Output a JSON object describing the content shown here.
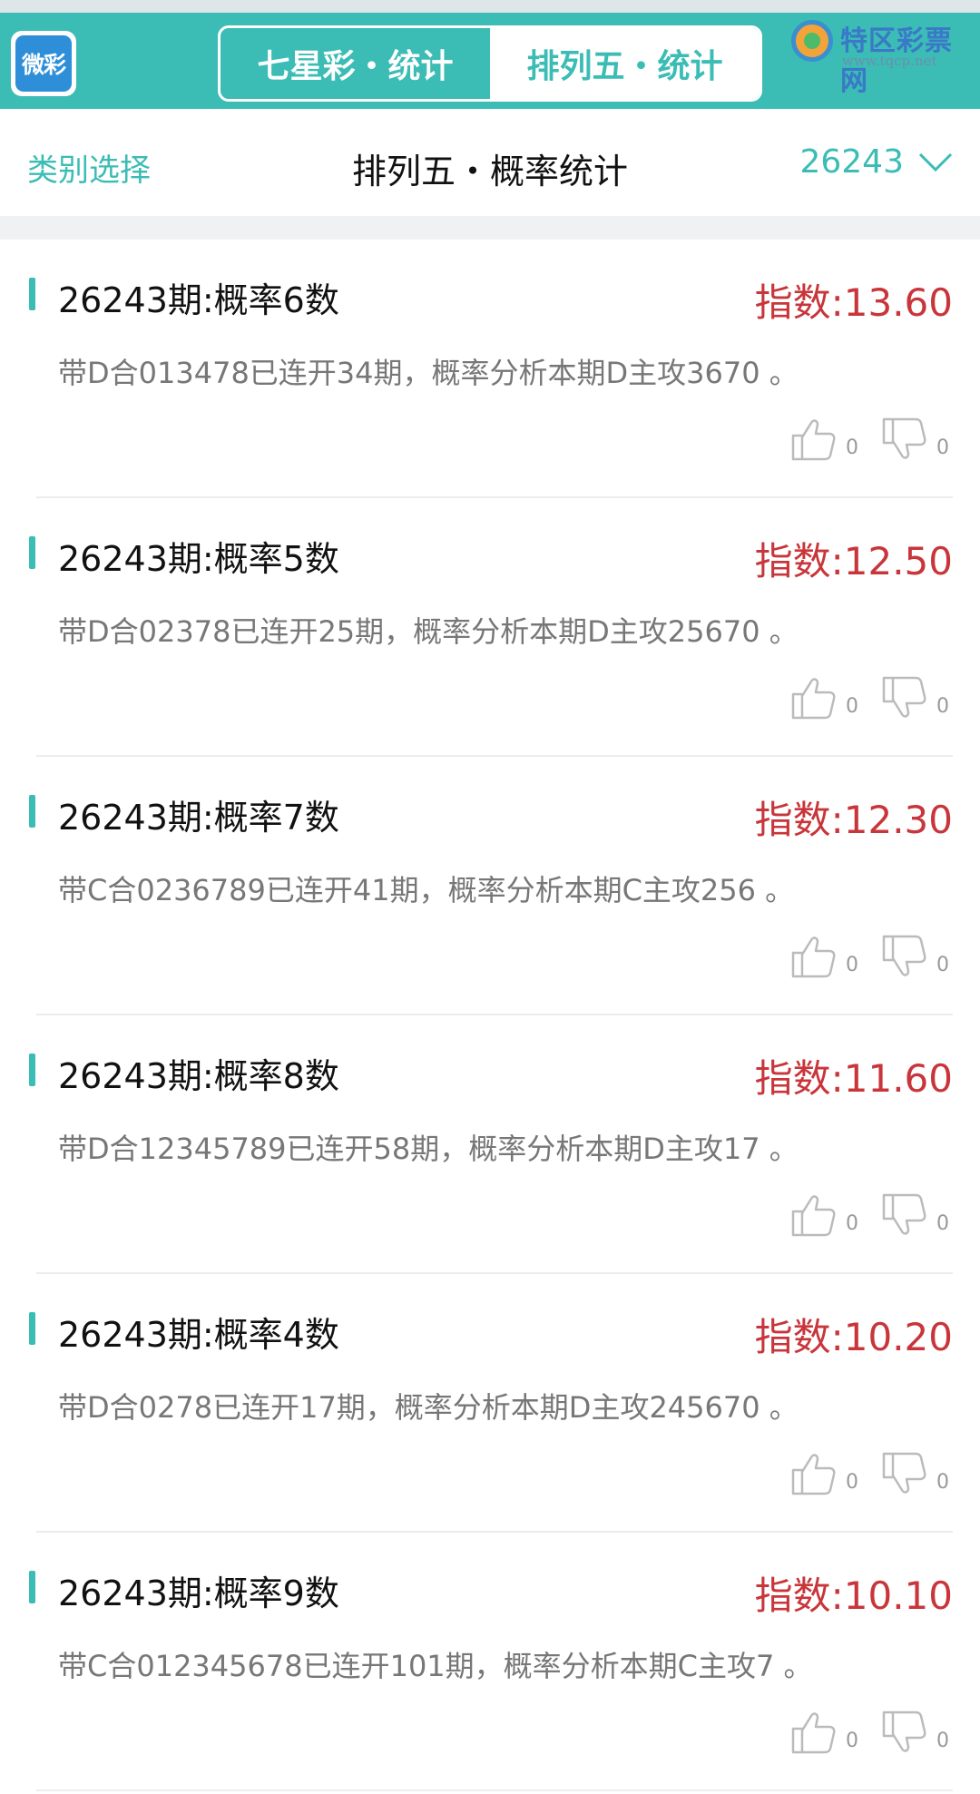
{
  "header": {
    "logo_text": "微彩",
    "tabs": [
      {
        "label": "七星彩・统计",
        "active": false
      },
      {
        "label": "排列五・统计",
        "active": true
      }
    ],
    "watermark": {
      "title": "特区彩票网",
      "url": "www.tqcp.net"
    }
  },
  "subheader": {
    "category_select": "类别选择",
    "title": "排列五・概率统计",
    "issue": "26243"
  },
  "colors": {
    "accent": "#3bbcb4",
    "index_red": "#c8353a"
  },
  "items": [
    {
      "title": "26243期:概率6数",
      "index": "指数:13.60",
      "desc": "带D合013478已连开34期，概率分析本期D主攻3670 。",
      "likes": "0",
      "dislikes": "0"
    },
    {
      "title": "26243期:概率5数",
      "index": "指数:12.50",
      "desc": "带D合02378已连开25期，概率分析本期D主攻25670 。",
      "likes": "0",
      "dislikes": "0"
    },
    {
      "title": "26243期:概率7数",
      "index": "指数:12.30",
      "desc": "带C合0236789已连开41期，概率分析本期C主攻256 。",
      "likes": "0",
      "dislikes": "0"
    },
    {
      "title": "26243期:概率8数",
      "index": "指数:11.60",
      "desc": "带D合12345789已连开58期，概率分析本期D主攻17 。",
      "likes": "0",
      "dislikes": "0"
    },
    {
      "title": "26243期:概率4数",
      "index": "指数:10.20",
      "desc": "带D合0278已连开17期，概率分析本期D主攻245670 。",
      "likes": "0",
      "dislikes": "0"
    },
    {
      "title": "26243期:概率9数",
      "index": "指数:10.10",
      "desc": "带C合012345678已连开101期，概率分析本期C主攻7 。",
      "likes": "0",
      "dislikes": "0"
    }
  ]
}
